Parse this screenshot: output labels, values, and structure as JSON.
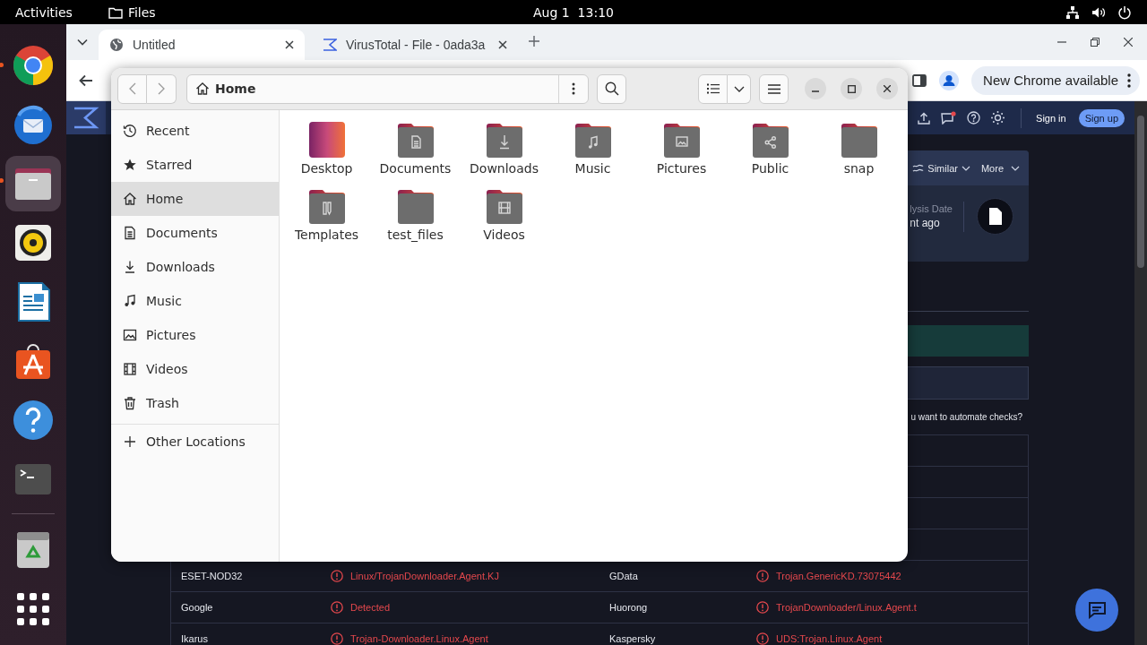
{
  "top_bar": {
    "activities": "Activities",
    "app": "Files",
    "clock": "Aug 1  13:10"
  },
  "dock": {
    "apps": [
      {
        "kind": "browser",
        "running": true,
        "selected": false
      },
      {
        "kind": "mail",
        "running": false,
        "selected": false
      },
      {
        "kind": "files",
        "running": true,
        "selected": true
      },
      {
        "kind": "music",
        "running": false,
        "selected": false
      },
      {
        "kind": "writer",
        "running": false,
        "selected": false
      },
      {
        "kind": "store",
        "running": false,
        "selected": false
      },
      {
        "kind": "help",
        "running": false,
        "selected": false
      },
      {
        "kind": "terminal",
        "running": false,
        "selected": false
      }
    ],
    "extras": [
      {
        "kind": "trash"
      },
      {
        "kind": "app-grid"
      }
    ]
  },
  "browser": {
    "tabs": [
      {
        "title": "Untitled",
        "kind": "globe",
        "selected": true
      },
      {
        "title": "VirusTotal - File - 0ada3a",
        "kind": "virustotal",
        "selected": false
      }
    ],
    "update_button": "New Chrome available",
    "page": {
      "sign_in": "Sign in",
      "sign_up": "Sign up",
      "card": {
        "similar": "Similar",
        "more": "More",
        "date_label": "lysis Date",
        "date_value": "nt ago"
      },
      "prompt": "u want to automate checks?",
      "detections": [
        [
          {
            "engine": "ESET-NOD32",
            "result": "Linux/TrojanDownloader.Agent.KJ"
          },
          {
            "engine": "GData",
            "result": "Trojan.GenericKD.73075442"
          }
        ],
        [
          {
            "engine": "Google",
            "result": "Detected"
          },
          {
            "engine": "Huorong",
            "result": "TrojanDownloader/Linux.Agent.t"
          }
        ],
        [
          {
            "engine": "Ikarus",
            "result": "Trojan-Downloader.Linux.Agent"
          },
          {
            "engine": "Kaspersky",
            "result": "UDS:Trojan.Linux.Agent"
          }
        ]
      ]
    }
  },
  "files": {
    "location": "Home",
    "sidebar": [
      {
        "label": "Recent",
        "kind": "recent",
        "selected": false
      },
      {
        "label": "Starred",
        "kind": "starred",
        "selected": false
      },
      {
        "label": "Home",
        "kind": "home",
        "selected": true
      },
      {
        "label": "Documents",
        "kind": "documents",
        "selected": false
      },
      {
        "label": "Downloads",
        "kind": "downloads",
        "selected": false
      },
      {
        "label": "Music",
        "kind": "music",
        "selected": false
      },
      {
        "label": "Pictures",
        "kind": "pictures",
        "selected": false
      },
      {
        "label": "Videos",
        "kind": "videos",
        "selected": false
      },
      {
        "label": "Trash",
        "kind": "trash",
        "selected": false
      },
      {
        "label": "Other Locations",
        "kind": "other",
        "selected": false
      }
    ],
    "folders": [
      {
        "name": "Desktop",
        "kind": "desktop"
      },
      {
        "name": "Documents",
        "kind": "documents"
      },
      {
        "name": "Downloads",
        "kind": "downloads"
      },
      {
        "name": "Music",
        "kind": "music"
      },
      {
        "name": "Pictures",
        "kind": "pictures"
      },
      {
        "name": "Public",
        "kind": "public"
      },
      {
        "name": "snap",
        "kind": "plain"
      },
      {
        "name": "Templates",
        "kind": "templates"
      },
      {
        "name": "test_files",
        "kind": "plain"
      },
      {
        "name": "Videos",
        "kind": "videos"
      }
    ]
  }
}
